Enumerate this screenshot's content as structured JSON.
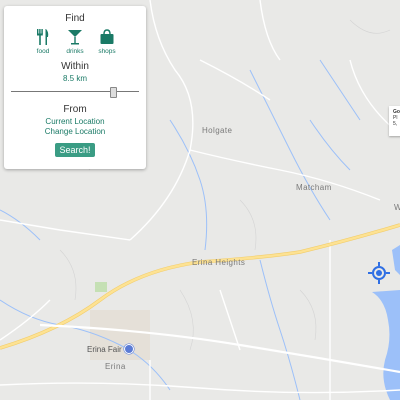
{
  "panel": {
    "find_label": "Find",
    "categories": [
      {
        "label": "food",
        "icon": "fork-knife-icon"
      },
      {
        "label": "drinks",
        "icon": "cocktail-glass-icon"
      },
      {
        "label": "shops",
        "icon": "shopping-bag-icon"
      }
    ],
    "within_label": "Within",
    "distance_value": "8.5 km",
    "slider_fraction": 0.8,
    "from_label": "From",
    "current_location": "Current Location",
    "change_location": "Change Location",
    "search_button": "Search!"
  },
  "map": {
    "place_labels": [
      "Holgate",
      "Matcham",
      "Erina Heights",
      "Erina",
      "W"
    ],
    "poi_label": "Erina Fair",
    "info_card_lines": [
      "Go",
      "Pl",
      "5,"
    ]
  },
  "colors": {
    "accent": "#1a7a66",
    "button": "#3a9c84",
    "water": "#9cc0f9",
    "highway": "#fde293",
    "road": "#ffffff",
    "land": "#e9e9e7"
  }
}
